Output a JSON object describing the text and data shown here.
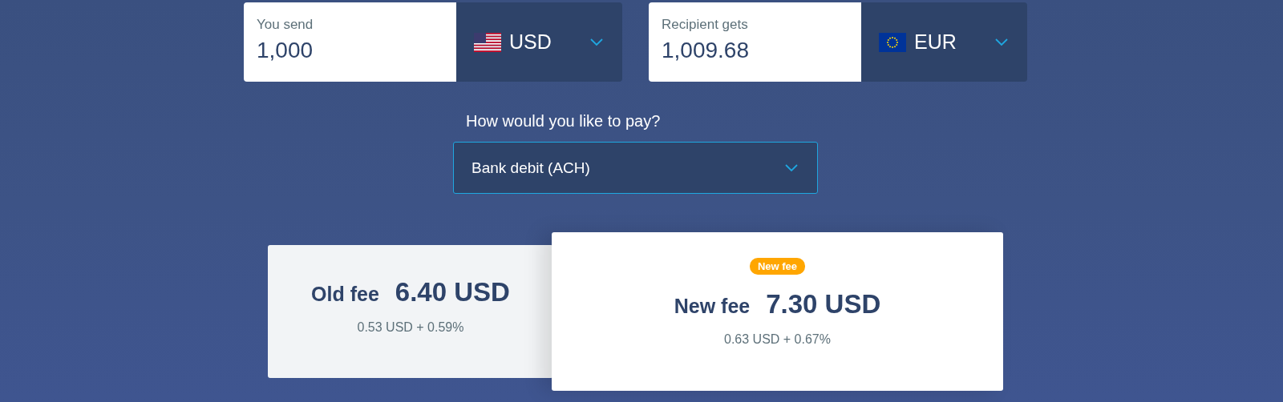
{
  "converter": [
    {
      "label": "You send",
      "value": "1,000",
      "currency": "USD",
      "kind": "us"
    },
    {
      "label": "Recipient gets",
      "value": "1,009.68",
      "currency": "EUR",
      "kind": "eu"
    }
  ],
  "payment": {
    "question": "How would you like to pay?",
    "value": "Bank debit (ACH)"
  },
  "fees": [
    {
      "kind": "old",
      "label": "Old fee",
      "amount": "6.40 USD",
      "breakdown": "0.53 USD + 0.59%"
    },
    {
      "kind": "new",
      "badge": "New fee",
      "label": "New fee",
      "amount": "7.30 USD",
      "breakdown": "0.63 USD + 0.67%"
    }
  ]
}
